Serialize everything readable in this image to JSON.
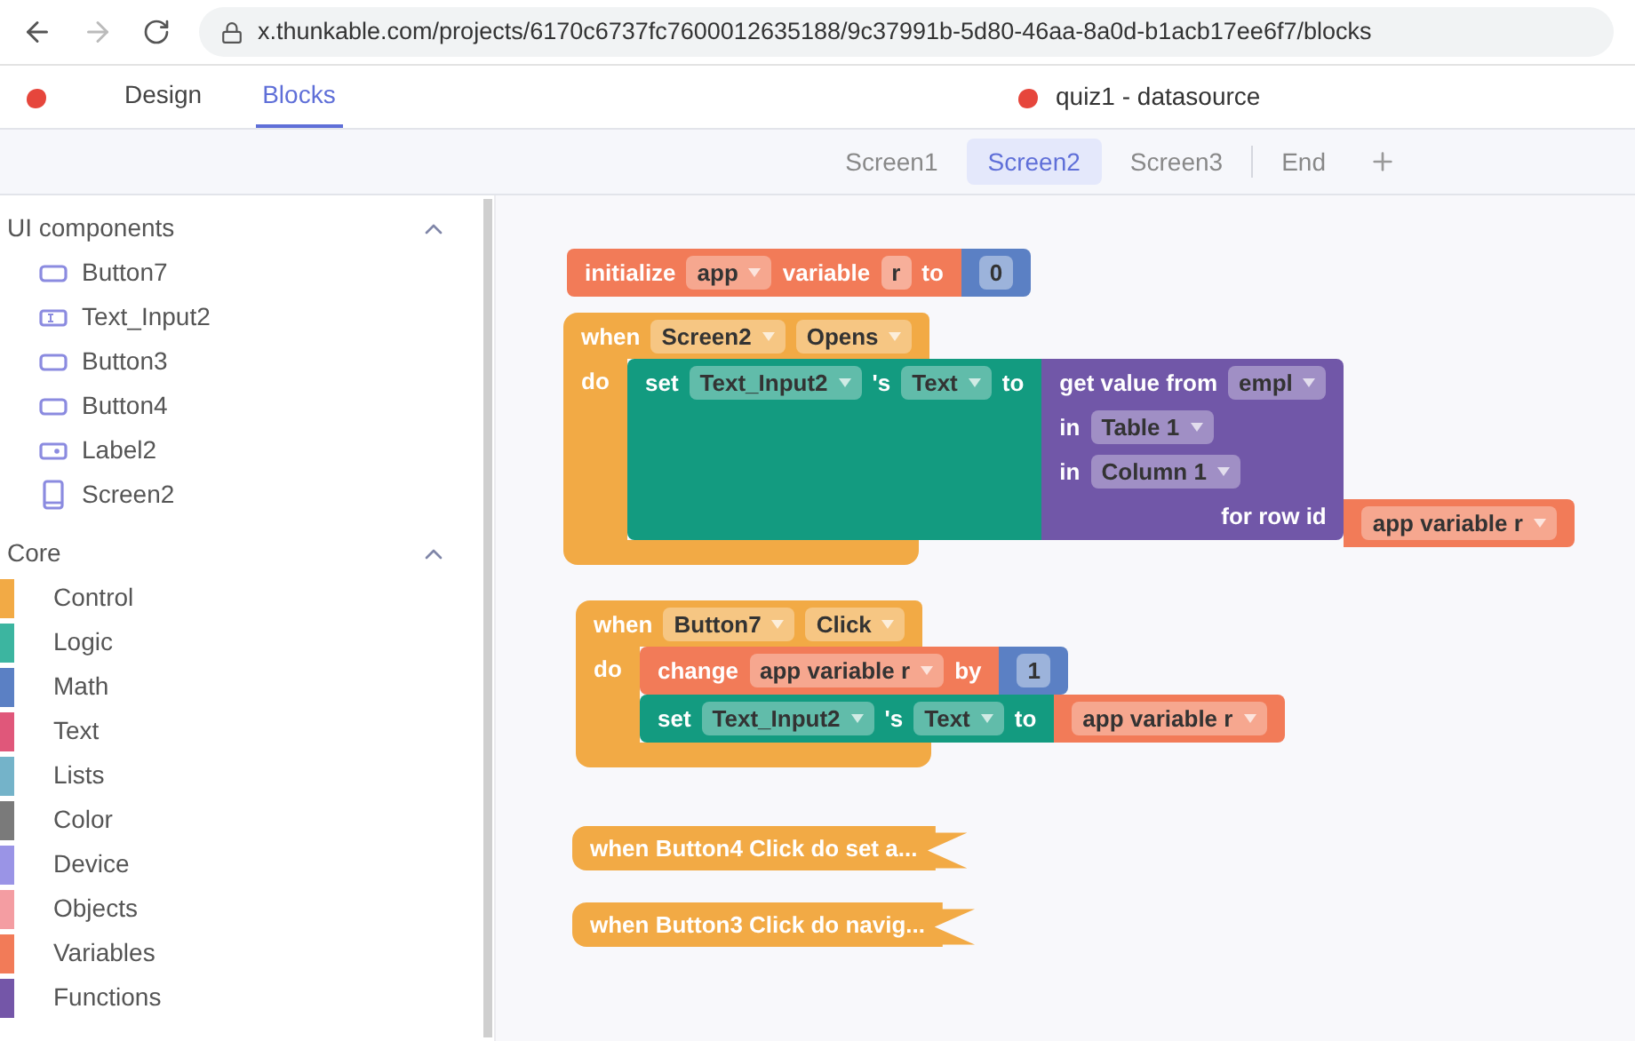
{
  "browser": {
    "url": "x.thunkable.com/projects/6170c6737fc7600012635188/9c37991b-5d80-46aa-8a0d-b1acb17ee6f7/blocks"
  },
  "app": {
    "tabs": [
      {
        "label": "Design",
        "selected": false
      },
      {
        "label": "Blocks",
        "selected": true
      }
    ],
    "project_title": "quiz1 - datasource"
  },
  "screens": [
    {
      "label": "Screen1",
      "selected": false
    },
    {
      "label": "Screen2",
      "selected": true
    },
    {
      "label": "Screen3",
      "selected": false
    },
    {
      "label": "End",
      "selected": false
    }
  ],
  "sidebar": {
    "sections": [
      {
        "title": "UI components",
        "expanded": true,
        "kind": "components",
        "items": [
          {
            "label": "Button7",
            "kind": "button"
          },
          {
            "label": "Text_Input2",
            "kind": "text_input"
          },
          {
            "label": "Button3",
            "kind": "button"
          },
          {
            "label": "Button4",
            "kind": "button"
          },
          {
            "label": "Label2",
            "kind": "label"
          },
          {
            "label": "Screen2",
            "kind": "screen"
          }
        ]
      },
      {
        "title": "Core",
        "expanded": true,
        "kind": "categories",
        "items": [
          {
            "label": "Control",
            "color": "#f2aa45"
          },
          {
            "label": "Logic",
            "color": "#3cb5a0"
          },
          {
            "label": "Math",
            "color": "#5b80c4"
          },
          {
            "label": "Text",
            "color": "#e0577a"
          },
          {
            "label": "Lists",
            "color": "#74b3c9"
          },
          {
            "label": "Color",
            "color": "#7a7a7a"
          },
          {
            "label": "Device",
            "color": "#9a94e6"
          },
          {
            "label": "Objects",
            "color": "#f49da2"
          },
          {
            "label": "Variables",
            "color": "#f27b58"
          },
          {
            "label": "Functions",
            "color": "#7456a8"
          }
        ]
      }
    ]
  },
  "blocks": [
    {
      "kind": "statement",
      "color": "#f27b58",
      "lines": [
        [
          {
            "kind": "word",
            "text": "initialize"
          },
          {
            "kind": "dropdown",
            "text": "app"
          },
          {
            "kind": "word",
            "text": "variable"
          },
          {
            "kind": "field",
            "text": "r"
          },
          {
            "kind": "word",
            "text": "to"
          }
        ]
      ],
      "input": {
        "kind": "value",
        "color": "#5b80c4",
        "lines": [
          [
            {
              "kind": "field",
              "text": "0"
            }
          ]
        ]
      }
    },
    {
      "kind": "event",
      "color": "#f2aa45",
      "lines": [
        [
          {
            "kind": "word",
            "text": "when"
          },
          {
            "kind": "dropdown",
            "text": "Screen2"
          },
          {
            "kind": "dropdown",
            "text": "Opens"
          }
        ]
      ],
      "do": "do",
      "body": [
        {
          "kind": "statement",
          "color": "#139b80",
          "lines": [
            [
              {
                "kind": "word",
                "text": "set"
              },
              {
                "kind": "dropdown",
                "text": "Text_Input2"
              },
              {
                "kind": "word",
                "text": "'s"
              },
              {
                "kind": "dropdown",
                "text": "Text"
              },
              {
                "kind": "word",
                "text": "to"
              }
            ]
          ],
          "input": {
            "kind": "value",
            "color": "#7157a8",
            "lines": [
              [
                {
                  "kind": "word",
                  "text": "get value from"
                },
                {
                  "kind": "dropdown",
                  "text": "empl"
                }
              ],
              [
                {
                  "kind": "word",
                  "text": "in"
                },
                {
                  "kind": "dropdown",
                  "text": "Table 1"
                }
              ],
              [
                {
                  "kind": "word",
                  "text": "in"
                },
                {
                  "kind": "dropdown",
                  "text": "Column 1"
                }
              ],
              [
                {
                  "kind": "word",
                  "text": "for row id"
                }
              ]
            ],
            "input": {
              "kind": "value",
              "color": "#f27b58",
              "lines": [
                [
                  {
                    "kind": "dropdown",
                    "text": "app variable r"
                  }
                ]
              ]
            }
          }
        }
      ]
    },
    {
      "kind": "event",
      "color": "#f2aa45",
      "lines": [
        [
          {
            "kind": "word",
            "text": "when"
          },
          {
            "kind": "dropdown",
            "text": "Button7"
          },
          {
            "kind": "dropdown",
            "text": "Click"
          }
        ]
      ],
      "do": "do",
      "body": [
        {
          "kind": "statement",
          "color": "#f27b58",
          "lines": [
            [
              {
                "kind": "word",
                "text": "change"
              },
              {
                "kind": "dropdown",
                "text": "app variable r"
              },
              {
                "kind": "word",
                "text": "by"
              }
            ]
          ],
          "input": {
            "kind": "value",
            "color": "#5b80c4",
            "lines": [
              [
                {
                  "kind": "field",
                  "text": "1"
                }
              ]
            ]
          }
        },
        {
          "kind": "statement",
          "color": "#139b80",
          "lines": [
            [
              {
                "kind": "word",
                "text": "set"
              },
              {
                "kind": "dropdown",
                "text": "Text_Input2"
              },
              {
                "kind": "word",
                "text": "'s"
              },
              {
                "kind": "dropdown",
                "text": "Text"
              },
              {
                "kind": "word",
                "text": "to"
              }
            ]
          ],
          "input": {
            "kind": "value",
            "color": "#f27b58",
            "lines": [
              [
                {
                  "kind": "dropdown",
                  "text": "app variable r"
                }
              ]
            ]
          }
        }
      ]
    },
    {
      "kind": "collapsed",
      "color": "#f2aa45",
      "text": "when Button4 Click do set a..."
    },
    {
      "kind": "collapsed",
      "color": "#f2aa45",
      "text": "when Button3 Click do navig..."
    }
  ]
}
